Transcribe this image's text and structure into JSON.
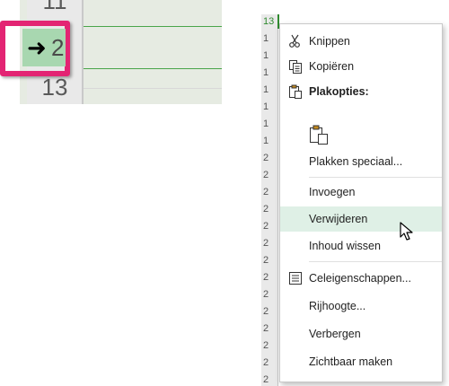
{
  "zoom": {
    "row_above": "11",
    "selected_row": "2",
    "row_below": "13",
    "arrow": "➜"
  },
  "row_strip": {
    "numbers": [
      "13",
      "1",
      "1",
      "1",
      "1",
      "1",
      "1",
      "1",
      "2",
      "2",
      "2",
      "2",
      "2",
      "2",
      "2",
      "2",
      "2",
      "2",
      "2",
      "2",
      "2",
      "2"
    ]
  },
  "context_menu": {
    "items": [
      {
        "label": "Knippen",
        "icon": "scissors-icon"
      },
      {
        "label": "Kopiëren",
        "icon": "copy-icon"
      },
      {
        "label": "Plakopties:",
        "icon": "paste-options-icon",
        "bold": true
      },
      {
        "label": "Plakken speciaal...",
        "icon": ""
      },
      {
        "label": "Invoegen",
        "icon": ""
      },
      {
        "label": "Verwijderen",
        "icon": "",
        "hover": true
      },
      {
        "label": "Inhoud wissen",
        "icon": ""
      },
      {
        "label": "Celeigenschappen...",
        "icon": "format-cells-icon"
      },
      {
        "label": "Rijhoogte...",
        "icon": ""
      },
      {
        "label": "Verbergen",
        "icon": ""
      },
      {
        "label": "Zichtbaar maken",
        "icon": ""
      }
    ]
  },
  "colors": {
    "highlight_border": "#e32473",
    "selected_cell": "#a8d7b0",
    "hover_bg": "#dff0e6",
    "excel_green": "#2f8a2f"
  }
}
